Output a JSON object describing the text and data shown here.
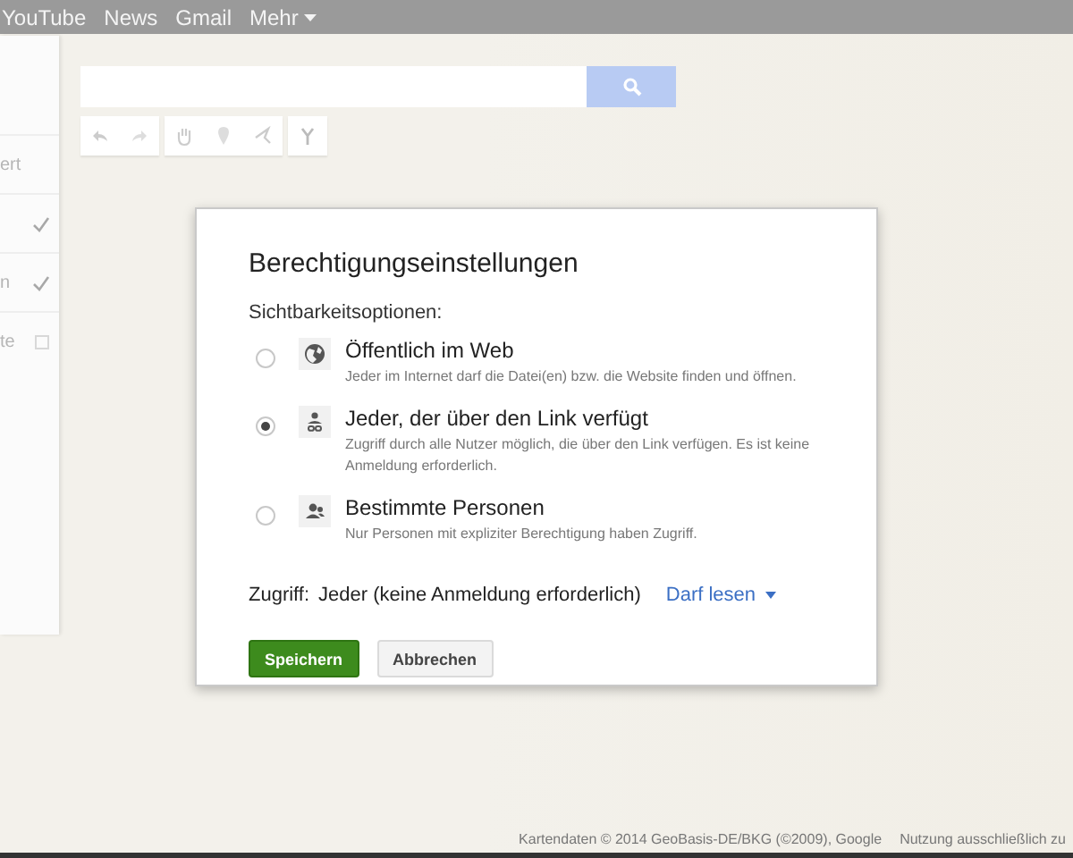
{
  "top_bar": {
    "links": [
      "YouTube",
      "News",
      "Gmail",
      "Mehr"
    ]
  },
  "sidebar": {
    "rows": [
      {
        "label": "ert",
        "kind": "text"
      },
      {
        "checked": true,
        "kind": "check"
      },
      {
        "label": "n",
        "checked": true,
        "kind": "check"
      },
      {
        "label": "te",
        "checked": false,
        "kind": "check"
      }
    ]
  },
  "map": {
    "attribution": "Kartendaten © 2014 GeoBasis-DE/BKG (©2009), Google",
    "terms": "Nutzung ausschließlich zu"
  },
  "dialog": {
    "title": "Berechtigungseinstellungen",
    "section_label": "Sichtbarkeitsoptionen:",
    "options": [
      {
        "kind": "public",
        "title": "Öffentlich im Web",
        "description": "Jeder im Internet darf die Datei(en) bzw. die Website finden und öffnen.",
        "selected": false
      },
      {
        "kind": "link",
        "title": "Jeder, der über den Link verfügt",
        "description": "Zugriff durch alle Nutzer möglich, die über den Link verfügen. Es ist keine Anmeldung erforderlich.",
        "selected": true
      },
      {
        "kind": "people",
        "title": "Bestimmte Personen",
        "description": "Nur Personen mit expliziter Berechtigung haben Zugriff.",
        "selected": false
      }
    ],
    "access": {
      "label": "Zugriff:",
      "value": "Jeder (keine Anmeldung erforderlich)",
      "permission": "Darf lesen"
    },
    "buttons": [
      {
        "label": "Speichern",
        "kind": "primary"
      },
      {
        "label": "Abbrechen",
        "kind": "secondary"
      }
    ]
  }
}
